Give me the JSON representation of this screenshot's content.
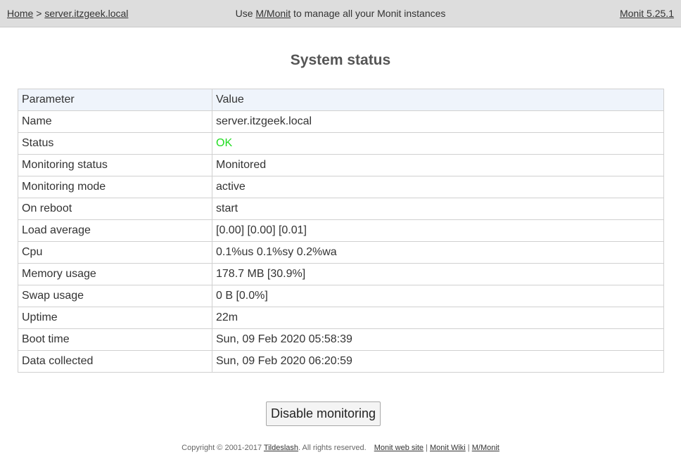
{
  "header": {
    "breadcrumb": {
      "home": "Home",
      "separator": " > ",
      "host": "server.itzgeek.local"
    },
    "center_prefix": "Use ",
    "center_link": "M/Monit",
    "center_suffix": " to manage all your Monit instances",
    "version": "Monit 5.25.1"
  },
  "page_title": "System status",
  "table": {
    "headers": [
      "Parameter",
      "Value"
    ],
    "rows": [
      {
        "param": "Name",
        "value": "server.itzgeek.local"
      },
      {
        "param": "Status",
        "value": "OK"
      },
      {
        "param": "Monitoring status",
        "value": "Monitored"
      },
      {
        "param": "Monitoring mode",
        "value": "active"
      },
      {
        "param": "On reboot",
        "value": "start"
      },
      {
        "param": "Load average",
        "value": "[0.00] [0.00] [0.01]"
      },
      {
        "param": "Cpu",
        "value": "0.1%us 0.1%sy 0.2%wa"
      },
      {
        "param": "Memory usage",
        "value": "178.7 MB [30.9%]"
      },
      {
        "param": "Swap usage",
        "value": "0 B [0.0%]"
      },
      {
        "param": "Uptime",
        "value": "22m"
      },
      {
        "param": "Boot time",
        "value": "Sun, 09 Feb 2020 05:58:39"
      },
      {
        "param": "Data collected",
        "value": "Sun, 09 Feb 2020 06:20:59"
      }
    ]
  },
  "button": {
    "label": "Disable monitoring"
  },
  "footer": {
    "copyright": "Copyright © 2001-2017 ",
    "company": "Tildeslash",
    "rights": ". All rights reserved.",
    "links": [
      "Monit web site",
      "Monit Wiki",
      "M/Monit"
    ],
    "separator": " | "
  },
  "colors": {
    "status_ok": "#22dd22",
    "header_bg": "#dddddd",
    "table_header_bg": "#eff4fb"
  }
}
